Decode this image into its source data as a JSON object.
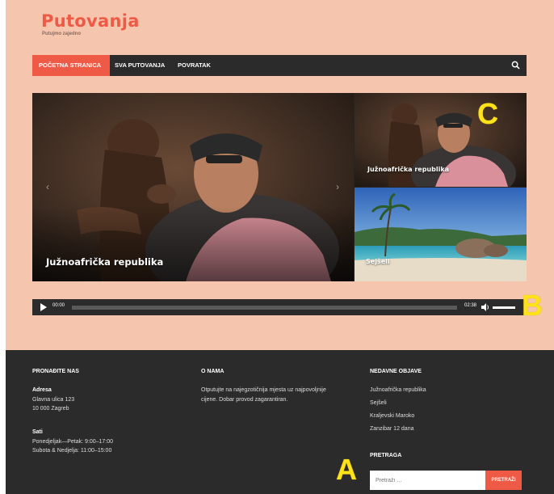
{
  "site": {
    "title": "Putovanja",
    "tagline": "Putujmo zajedno"
  },
  "nav": {
    "items": [
      {
        "label": "POČETNA STRANICA",
        "active": true
      },
      {
        "label": "SVA PUTOVANJA",
        "active": false
      },
      {
        "label": "POVRATAK",
        "active": false
      }
    ],
    "search_icon": "search-icon"
  },
  "slider": {
    "main_caption": "Južnoafrička republika",
    "side1_caption": "Južnoafrička republika",
    "side2_caption": "Sejšeli",
    "prev_icon": "‹",
    "next_icon": "›"
  },
  "audio": {
    "current_time": "00:00",
    "duration": "02:38",
    "progress": 0.0,
    "volume": 1.0
  },
  "markers": {
    "a": "A",
    "b": "B",
    "c": "C"
  },
  "footer": {
    "find_us": {
      "title": "PRONAĐITE NAS",
      "address_label": "Adresa",
      "address_line1": "Glavna ulica 123",
      "address_line2": "10 000 Zagreb",
      "hours_label": "Sati",
      "hours_line1": "Ponedjeljak—Petak: 9:00–17:00",
      "hours_line2": "Subota & Nedjelja: 11:00–15:00"
    },
    "about": {
      "title": "O NAMA",
      "text_line1": "Otputujte na najegzotičnija mjesta uz najpovoljnije",
      "text_line2": "cijene. Dobar provod zagarantiran."
    },
    "recent": {
      "title": "NEDAVNE OBJAVE",
      "posts": [
        "Južnoafrička republika",
        "Sejšeli",
        "Kraljevski Maroko",
        "Zanzibar 12 dana"
      ]
    },
    "search": {
      "title": "PRETRAGA",
      "placeholder": "Pretraži …",
      "button": "PRETRAŽI"
    }
  },
  "colors": {
    "accent": "#ee5a45",
    "page_bg": "#f5c6ad",
    "dark": "#2b2b2b",
    "marker": "#ffe21a"
  }
}
